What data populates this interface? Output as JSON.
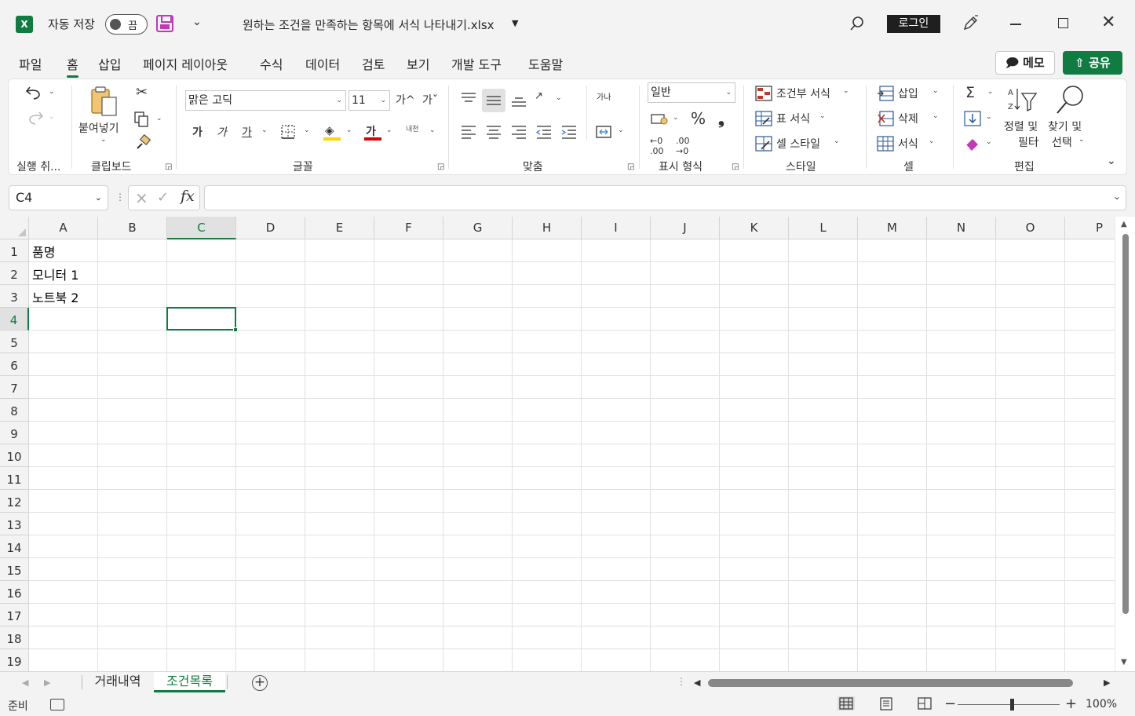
{
  "titlebar": {
    "app_logo": "X",
    "autosave_label": "자동 저장",
    "autosave_state": "끔",
    "file_title": "원하는 조건을 만족하는 항목에 서식 나타내기.xlsx",
    "login_label": "로그인"
  },
  "menu": {
    "tabs": [
      "파일",
      "홈",
      "삽입",
      "페이지 레이아웃",
      "수식",
      "데이터",
      "검토",
      "보기",
      "개발 도구",
      "도움말"
    ],
    "active_tab": "홈",
    "memo_label": "메모",
    "share_label": "공유"
  },
  "ribbon": {
    "groups": {
      "undo": "실행 취...",
      "clipboard": "클립보드",
      "font": "글꼴",
      "alignment": "맞춤",
      "number": "표시 형식",
      "styles": "스타일",
      "cells": "셀",
      "editing": "편집"
    },
    "paste_label": "붙여넣기",
    "font_name": "맑은 고딕",
    "font_size": "11",
    "bold_glyph": "가",
    "italic_glyph": "가",
    "underline_glyph": "가",
    "font_color_glyph": "가",
    "grow_font": "가^",
    "shrink_font": "가ˇ",
    "phonetic_label": "내천",
    "wrap_label": "가나",
    "number_format": "일반",
    "percent_glyph": "%",
    "comma_glyph": "❟",
    "conditional_format": "조건부 서식",
    "format_as_table": "표 서식",
    "cell_styles": "셀 스타일",
    "insert": "삽입",
    "delete": "삭제",
    "format": "서식",
    "sort_filter_line1": "정렬 및",
    "sort_filter_line2": "필터",
    "find_select_line1": "찾기 및",
    "find_select_line2": "선택"
  },
  "formula_bar": {
    "name_box": "C4",
    "fx_label": "fx",
    "formula": ""
  },
  "sheet": {
    "columns": [
      "A",
      "B",
      "C",
      "D",
      "E",
      "F",
      "G",
      "H",
      "I",
      "J",
      "K",
      "L",
      "M",
      "N",
      "O",
      "P"
    ],
    "selected_column": "C",
    "rows": [
      "1",
      "2",
      "3",
      "4",
      "5",
      "6",
      "7",
      "8",
      "9",
      "10",
      "11",
      "12",
      "13",
      "14",
      "15",
      "16",
      "17",
      "18",
      "19"
    ],
    "selected_row": "4",
    "cells": {
      "A1": "품명",
      "A2": "모니터 1",
      "A3": "노트북 2"
    }
  },
  "sheet_tabs": {
    "tabs": [
      "거래내역",
      "조건목록"
    ],
    "active_tab": "조건목록",
    "add_label": "+"
  },
  "statusbar": {
    "status": "준비",
    "zoom": "100%"
  },
  "colors": {
    "accent": "#107c41",
    "cond_icon": "#c0392b",
    "fill_yellow": "#ffd600",
    "font_red": "#e00000",
    "save_purple": "#c239b3"
  }
}
